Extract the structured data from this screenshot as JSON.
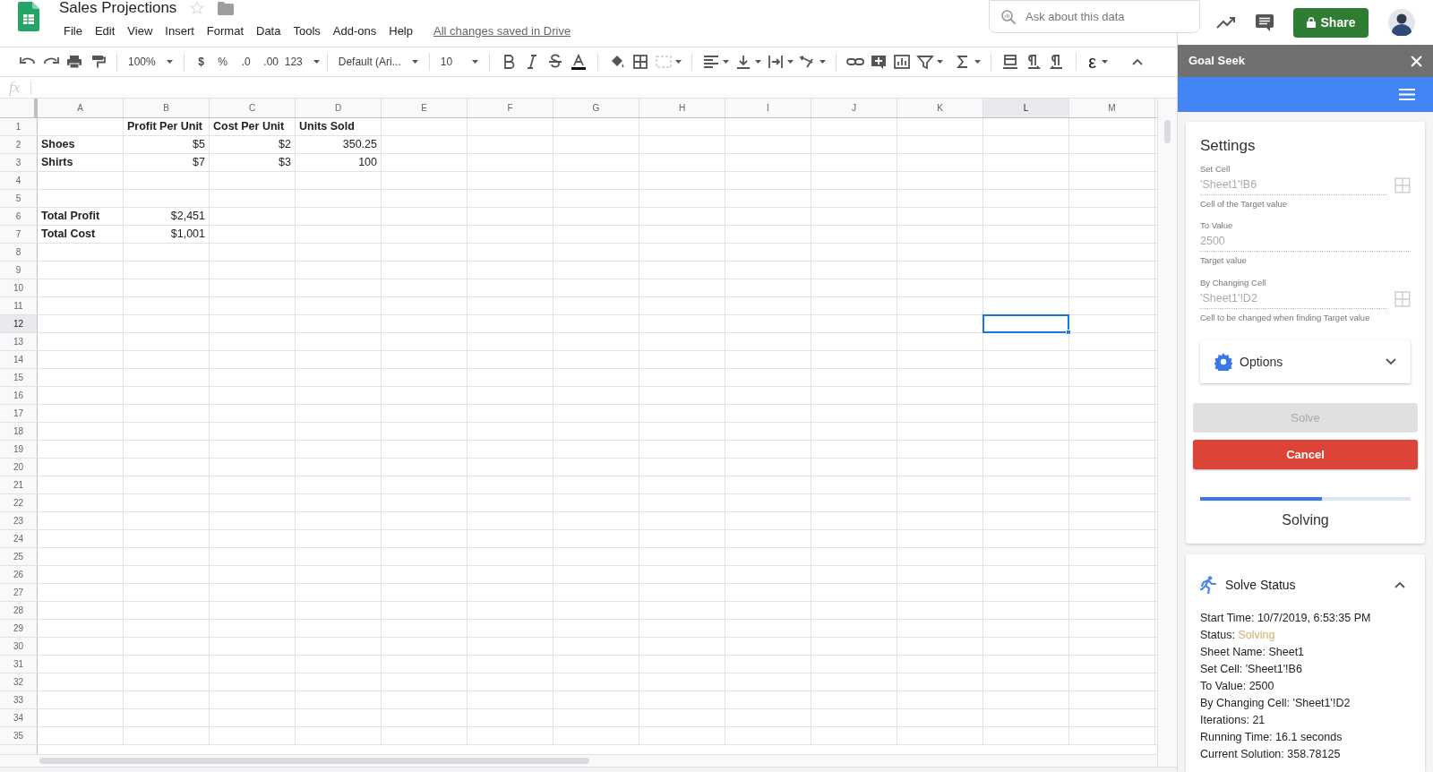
{
  "document": {
    "title": "Sales Projections",
    "save_status": "All changes saved in Drive"
  },
  "menu": [
    "File",
    "Edit",
    "View",
    "Insert",
    "Format",
    "Data",
    "Tools",
    "Add-ons",
    "Help"
  ],
  "search": {
    "placeholder": "Ask about this data"
  },
  "share_button": "Share",
  "toolbar": {
    "zoom": "100%",
    "currency": "$",
    "percent": "%",
    "decrease_decimals": ".0",
    "increase_decimals": ".00",
    "number_format": "123",
    "font": "Default (Ari...",
    "font_size": "10",
    "equation": "ε"
  },
  "formula_bar": {
    "label": "fx"
  },
  "sheet": {
    "columns": [
      {
        "label": "A",
        "selected": false
      },
      {
        "label": "B",
        "selected": false
      },
      {
        "label": "C",
        "selected": false
      },
      {
        "label": "D",
        "selected": false
      },
      {
        "label": "E",
        "selected": false
      },
      {
        "label": "F",
        "selected": false
      },
      {
        "label": "G",
        "selected": false
      },
      {
        "label": "H",
        "selected": false
      },
      {
        "label": "I",
        "selected": false
      },
      {
        "label": "J",
        "selected": false
      },
      {
        "label": "K",
        "selected": false
      },
      {
        "label": "L",
        "selected": true
      },
      {
        "label": "M",
        "selected": false
      }
    ],
    "rows": [
      {
        "label": "1",
        "selected": false,
        "cells": {
          "B": {
            "text": "Profit Per Unit",
            "kind": "label"
          },
          "C": {
            "text": "Cost Per Unit",
            "kind": "label"
          },
          "D": {
            "text": "Units Sold",
            "kind": "label"
          }
        }
      },
      {
        "label": "2",
        "selected": false,
        "cells": {
          "A": {
            "text": "Shoes",
            "kind": "label"
          },
          "B": {
            "text": "$5",
            "kind": "number"
          },
          "C": {
            "text": "$2",
            "kind": "number"
          },
          "D": {
            "text": "350.25",
            "kind": "number"
          }
        }
      },
      {
        "label": "3",
        "selected": false,
        "cells": {
          "A": {
            "text": "Shirts",
            "kind": "label"
          },
          "B": {
            "text": "$7",
            "kind": "number"
          },
          "C": {
            "text": "$3",
            "kind": "number"
          },
          "D": {
            "text": "100",
            "kind": "number"
          }
        }
      },
      {
        "label": "4",
        "selected": false
      },
      {
        "label": "5",
        "selected": false
      },
      {
        "label": "6",
        "selected": false,
        "cells": {
          "A": {
            "text": "Total Profit",
            "kind": "label"
          },
          "B": {
            "text": "$2,451",
            "kind": "number"
          }
        }
      },
      {
        "label": "7",
        "selected": false,
        "cells": {
          "A": {
            "text": "Total Cost",
            "kind": "label"
          },
          "B": {
            "text": "$1,001",
            "kind": "number"
          }
        }
      },
      {
        "label": "8",
        "selected": false
      },
      {
        "label": "9",
        "selected": false
      },
      {
        "label": "10",
        "selected": false
      },
      {
        "label": "11",
        "selected": false
      },
      {
        "label": "12",
        "selected": true
      },
      {
        "label": "13",
        "selected": false
      },
      {
        "label": "14",
        "selected": false
      },
      {
        "label": "15",
        "selected": false
      },
      {
        "label": "16",
        "selected": false
      },
      {
        "label": "17",
        "selected": false
      },
      {
        "label": "18",
        "selected": false
      },
      {
        "label": "19",
        "selected": false
      },
      {
        "label": "20",
        "selected": false
      },
      {
        "label": "21",
        "selected": false
      },
      {
        "label": "22",
        "selected": false
      },
      {
        "label": "23",
        "selected": false
      },
      {
        "label": "24",
        "selected": false
      },
      {
        "label": "25",
        "selected": false
      },
      {
        "label": "26",
        "selected": false
      },
      {
        "label": "27",
        "selected": false
      },
      {
        "label": "28",
        "selected": false
      },
      {
        "label": "29",
        "selected": false
      },
      {
        "label": "30",
        "selected": false
      },
      {
        "label": "31",
        "selected": false
      },
      {
        "label": "32",
        "selected": false
      },
      {
        "label": "33",
        "selected": false
      },
      {
        "label": "34",
        "selected": false
      },
      {
        "label": "35",
        "selected": false
      }
    ]
  },
  "goal_seek": {
    "title": "Goal Seek",
    "settings": {
      "heading": "Settings",
      "fields": [
        {
          "label": "Set Cell",
          "value": "'Sheet1'!B6",
          "hint": "Cell of the Target value",
          "kind": "range"
        },
        {
          "label": "To Value",
          "value": "2500",
          "hint": "Target value",
          "kind": "number"
        },
        {
          "label": "By Changing Cell",
          "value": "'Sheet1'!D2",
          "hint": "Cell to be changed when finding Target value",
          "kind": "range"
        }
      ]
    },
    "options": {
      "label": "Options",
      "expanded": false
    },
    "solve_button": {
      "label": "Solve",
      "disabled": true
    },
    "cancel_button": "Cancel",
    "progress": {
      "level": 0.58,
      "label": "Solving"
    },
    "status": {
      "title": "Solve Status",
      "expanded": true,
      "lines": [
        {
          "label": "Start Time:",
          "value": "10/7/2019, 6:53:35 PM",
          "kind": "plain"
        },
        {
          "label": "Status:",
          "value": "Solving",
          "kind": "state"
        },
        {
          "label": "Sheet Name:",
          "value": "Sheet1",
          "kind": "plain"
        },
        {
          "label": "Set Cell:",
          "value": "'Sheet1'!B6",
          "kind": "plain"
        },
        {
          "label": "To Value:",
          "value": "2500",
          "kind": "plain"
        },
        {
          "label": "By Changing Cell:",
          "value": "'Sheet1'!D2",
          "kind": "plain"
        },
        {
          "label": "Iterations:",
          "value": "21",
          "kind": "plain"
        },
        {
          "label": "Running Time:",
          "value": "16.1 seconds",
          "kind": "plain"
        },
        {
          "label": "Current Solution:",
          "value": "358.78125",
          "kind": "plain"
        }
      ]
    }
  }
}
